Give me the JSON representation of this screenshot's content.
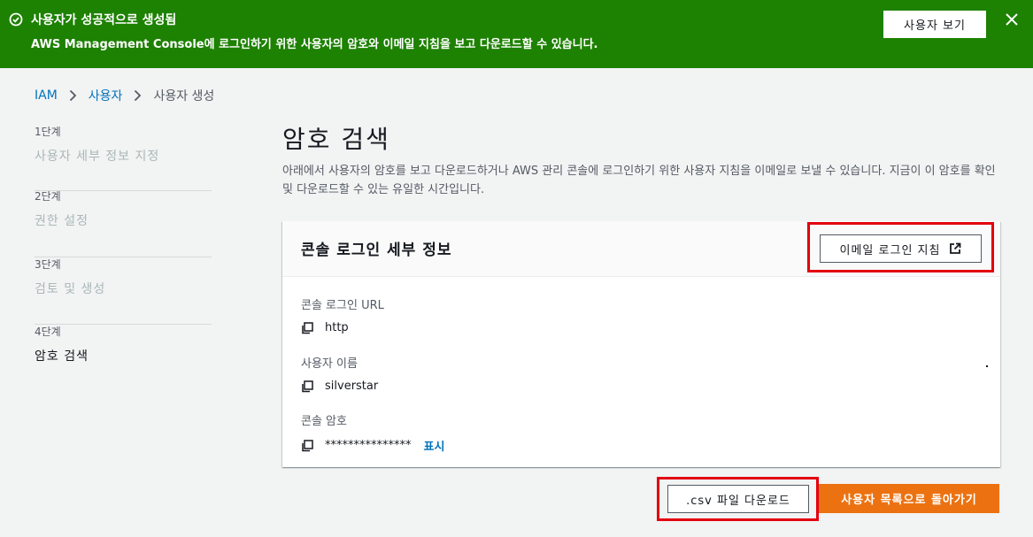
{
  "banner": {
    "title": "사용자가 성공적으로 생성됨",
    "message": "AWS Management Console에 로그인하기 위한 사용자의 암호와 이메일 지침을 보고 다운로드할 수 있습니다.",
    "view_button": "사용자 보기",
    "color": "#1d8102"
  },
  "breadcrumb": {
    "items": [
      "IAM",
      "사용자",
      "사용자 생성"
    ]
  },
  "steps": [
    {
      "num": "1단계",
      "name": "사용자 세부 정보 지정"
    },
    {
      "num": "2단계",
      "name": "권한 설정"
    },
    {
      "num": "3단계",
      "name": "검토 및 생성"
    },
    {
      "num": "4단계",
      "name": "암호 검색"
    }
  ],
  "main": {
    "title": "암호 검색",
    "description": "아래에서 사용자의 암호를 보고 다운로드하거나 AWS 관리 콘솔에 로그인하기 위한 사용자 지침을 이메일로 보낼 수 있습니다. 지금이 이 암호를 확인 및 다운로드할 수 있는 유일한 시간입니다."
  },
  "card": {
    "heading": "콘솔 로그인 세부 정보",
    "email_button": "이메일 로그인 지침",
    "fields": {
      "url_label": "콘솔 로그인 URL",
      "url_value": "http",
      "user_label": "사용자 이름",
      "user_value": "silverstar",
      "password_label": "콘솔 암호",
      "password_value": "***************",
      "show_link": "표시"
    }
  },
  "footer": {
    "csv_button": ".csv 파일 다운로드",
    "back_button": "사용자 목록으로 돌아가기",
    "accent": "#ec7211"
  }
}
